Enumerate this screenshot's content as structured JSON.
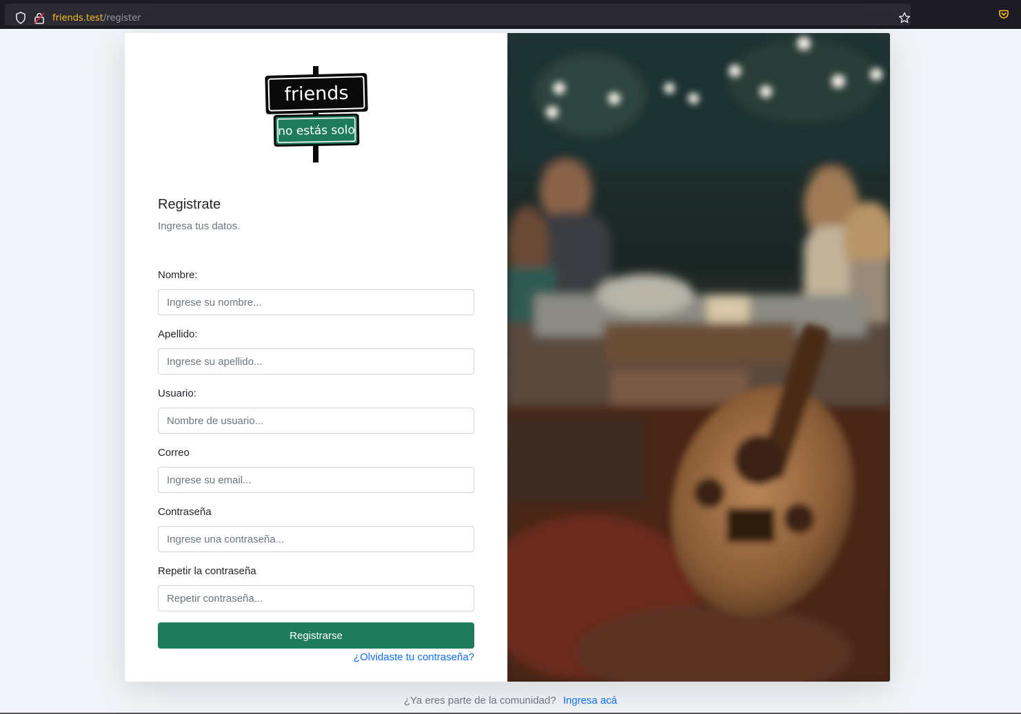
{
  "browser": {
    "url_host": "friends.test",
    "url_path": "/register"
  },
  "logo": {
    "brand": "friends",
    "tagline": "no estás solo",
    "accent": "#1e7b5c"
  },
  "form": {
    "title": "Registrate",
    "subtitle": "Ingresa tus datos.",
    "fields": [
      {
        "label": "Nombre:",
        "placeholder": "Ingrese su nombre..."
      },
      {
        "label": "Apellido:",
        "placeholder": "Ingrese su apellido..."
      },
      {
        "label": "Usuario:",
        "placeholder": "Nombre de usuario..."
      },
      {
        "label": "Correo",
        "placeholder": "Ingrese su email..."
      },
      {
        "label": "Contraseña",
        "placeholder": "Ingrese una contraseña..."
      },
      {
        "label": "Repetir la contraseña",
        "placeholder": "Repetir contraseña..."
      }
    ],
    "submit_label": "Registrarse",
    "forgot_label": "¿Olvidaste tu contraseña?"
  },
  "footer": {
    "text": "¿Ya eres parte de la comunidad?",
    "link_label": "Ingresa acá"
  },
  "colors": {
    "primary": "#1e7b5c",
    "link": "#0d6efd",
    "page_bg": "#f1f4f8"
  }
}
